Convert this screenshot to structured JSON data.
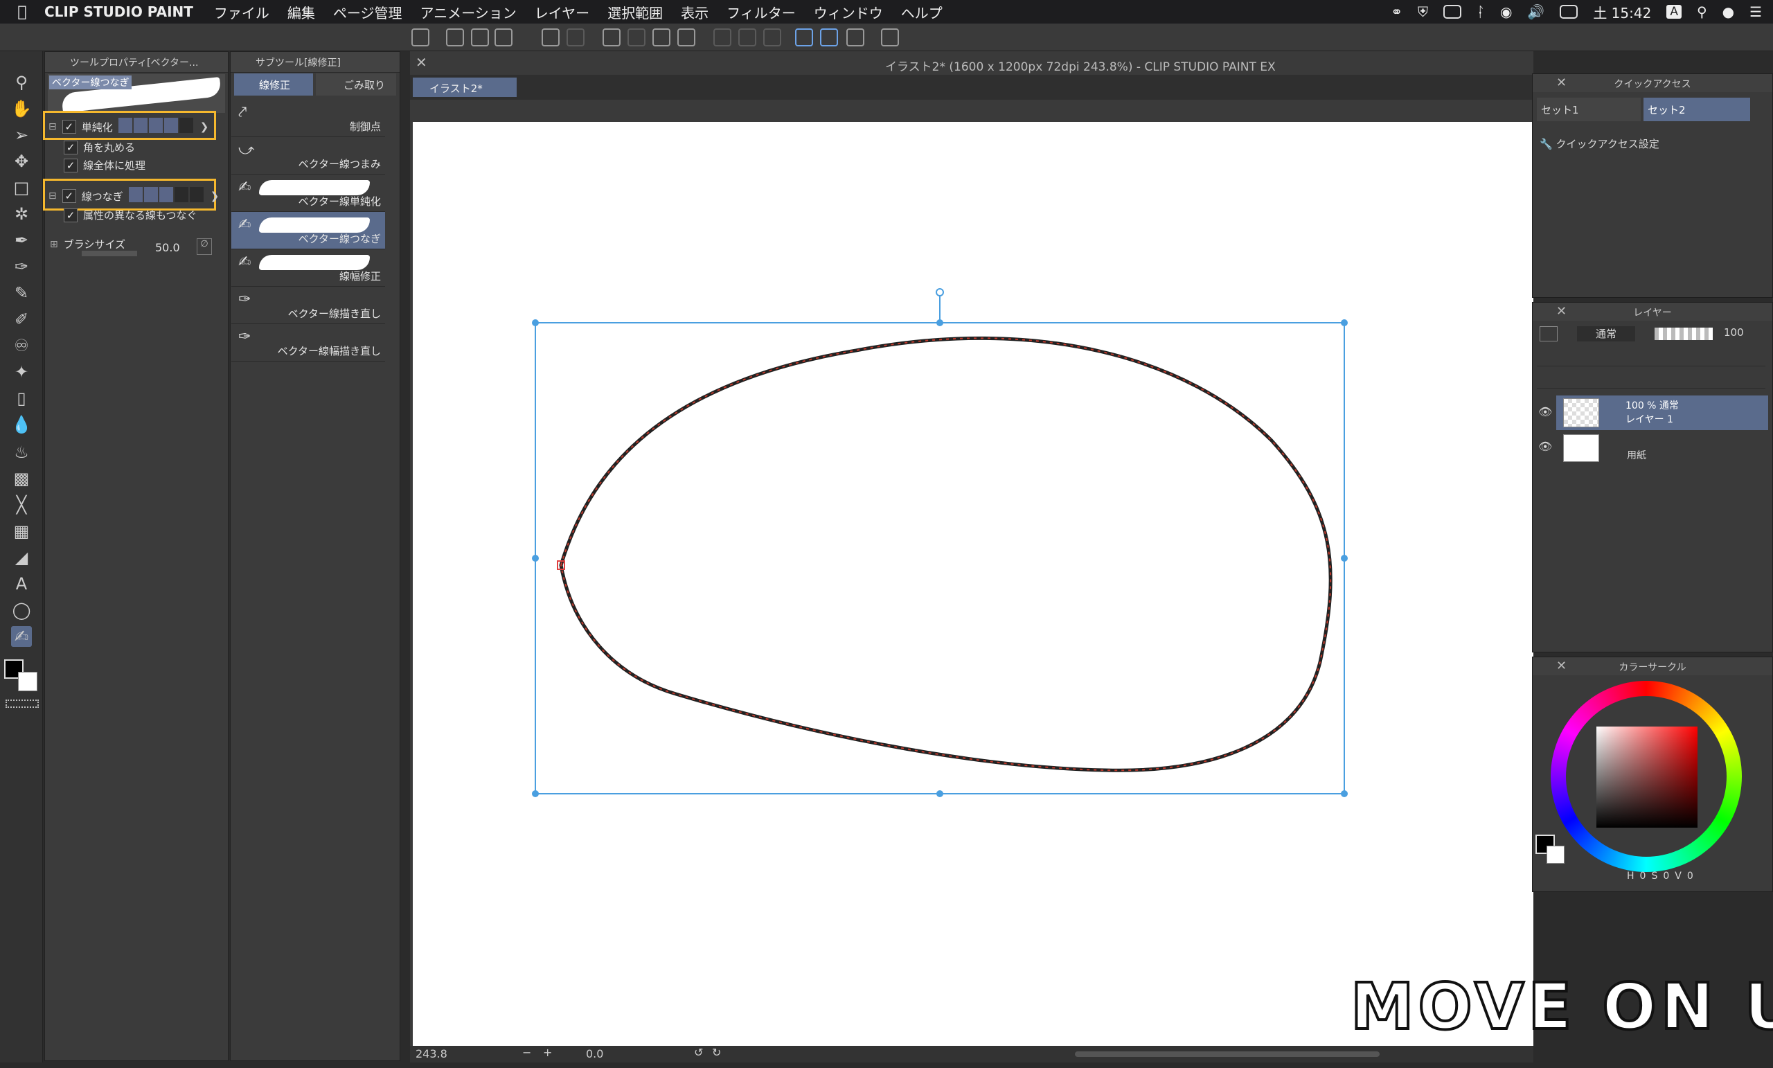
{
  "menubar": {
    "app_name": "CLIP STUDIO PAINT",
    "items": [
      "ファイル",
      "編集",
      "ページ管理",
      "アニメーション",
      "レイヤー",
      "選択範囲",
      "表示",
      "フィルター",
      "ウィンドウ",
      "ヘルプ"
    ],
    "clock": "土 15:42",
    "input_indicator": "A"
  },
  "tool_property": {
    "header": "ツールプロパティ[ベクター...",
    "preview_label": "ベクター線つなぎ",
    "simplify_label": "単純化",
    "round_corners_label": "角を丸める",
    "process_whole_label": "線全体に処理",
    "connect_label": "線つなぎ",
    "connect_different_label": "属性の異なる線もつなぐ",
    "brush_size_label": "ブラシサイズ",
    "brush_size_value": "50.0"
  },
  "subtool": {
    "header": "サブツール[線修正]",
    "tab_fix": "線修正",
    "tab_dust": "ごみ取り",
    "items": [
      "制御点",
      "ベクター線つまみ",
      "ベクター線単純化",
      "ベクター線つなぎ",
      "線幅修正",
      "ベクター線描き直し",
      "ベクター線幅描き直し"
    ]
  },
  "document": {
    "window_title": "イラスト2* (1600 x 1200px 72dpi 243.8%)  - CLIP STUDIO PAINT EX",
    "tab_label": "イラスト2*"
  },
  "statusbar": {
    "zoom": "243.8",
    "rotation": "0.0"
  },
  "quick_access": {
    "title": "クイックアクセス",
    "set1": "セット1",
    "set2": "セット2",
    "settings_label": "クイックアクセス設定"
  },
  "layers": {
    "title": "レイヤー",
    "blend_mode": "通常",
    "opacity": "100",
    "layer1_info": "100 % 通常",
    "layer1_name": "レイヤー 1",
    "paper_name": "用紙"
  },
  "color_circle": {
    "title": "カラーサークル",
    "h_label": "H",
    "h_value": "0",
    "s_label": "S",
    "s_value": "0",
    "v_label": "V",
    "v_value": "0"
  },
  "watermark": {
    "text": "MOVE ON UP"
  },
  "colors": {
    "accent": "#5a6b8c",
    "highlight": "#f5b82e",
    "selection": "#4a9fe0"
  }
}
